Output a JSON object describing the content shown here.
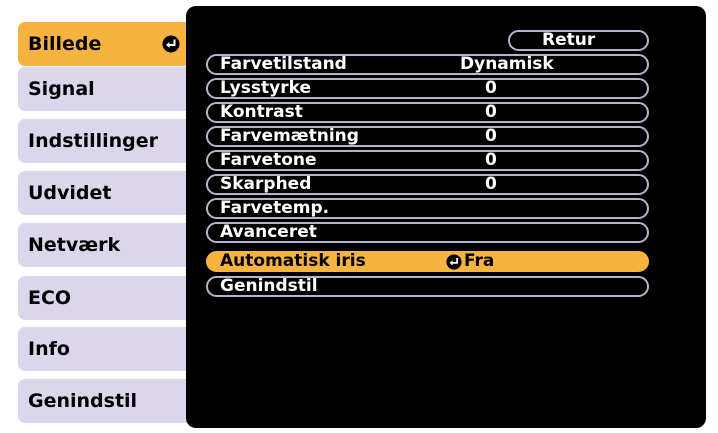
{
  "sidebar": {
    "items": [
      {
        "label": "Billede",
        "active": true
      },
      {
        "label": "Signal"
      },
      {
        "label": "Indstillinger"
      },
      {
        "label": "Udvidet"
      },
      {
        "label": "Netværk"
      },
      {
        "label": "ECO"
      },
      {
        "label": "Info"
      },
      {
        "label": "Genindstil"
      }
    ]
  },
  "panel": {
    "return_label": "Retur",
    "rows": [
      {
        "label": "Farvetilstand",
        "value": "Dynamisk"
      },
      {
        "label": "Lysstyrke",
        "value": "0"
      },
      {
        "label": "Kontrast",
        "value": "0"
      },
      {
        "label": "Farvemætning",
        "value": "0"
      },
      {
        "label": "Farvetone",
        "value": "0"
      },
      {
        "label": "Skarphed",
        "value": "0"
      },
      {
        "label": "Farvetemp.",
        "value": ""
      },
      {
        "label": "Avanceret",
        "value": ""
      },
      {
        "label": "Automatisk iris",
        "value": "Fra",
        "selected": true,
        "icon": "enter-icon"
      },
      {
        "label": "Genindstil",
        "value": ""
      }
    ]
  },
  "colors": {
    "highlight": "#f7b340",
    "tab": "#dcd6ec",
    "panel": "#000000",
    "row_border": "#b9b2cf"
  }
}
